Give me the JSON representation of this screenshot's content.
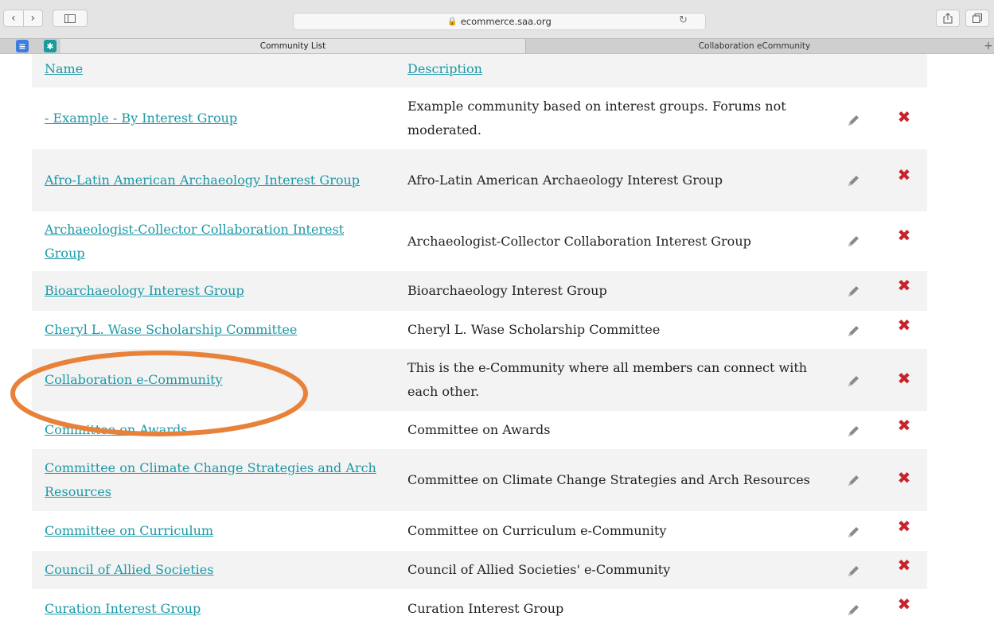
{
  "browser": {
    "url": "ecommerce.saa.org",
    "tabs": [
      {
        "label": "Community List",
        "active": true
      },
      {
        "label": "Collaboration eCommunity",
        "active": false
      }
    ]
  },
  "table": {
    "headers": {
      "name": "Name",
      "description": "Description"
    },
    "rows": [
      {
        "name": "- Example - By Interest Group",
        "description": "Example community based on interest groups. Forums not moderated."
      },
      {
        "name": "Afro-Latin American Archaeology Interest Group",
        "description": "Afro-Latin American Archaeology Interest Group"
      },
      {
        "name": "Archaeologist-Collector Collaboration Interest Group",
        "description": "Archaeologist-Collector Collaboration Interest Group"
      },
      {
        "name": "Bioarchaeology Interest Group",
        "description": "Bioarchaeology Interest Group"
      },
      {
        "name": "Cheryl L. Wase Scholarship Committee",
        "description": "Cheryl L. Wase Scholarship Committee"
      },
      {
        "name": "Collaboration e-Community",
        "description": "This is the e-Community where all members can connect with each other.",
        "highlighted": true
      },
      {
        "name": "Committee on Awards",
        "description": "Committee on Awards"
      },
      {
        "name": "Committee on Climate Change Strategies and Arch Resources",
        "description": "Committee on Climate Change Strategies and Arch Resources"
      },
      {
        "name": "Committee on Curriculum",
        "description": "Committee on Curriculum e-Community"
      },
      {
        "name": "Council of Allied Societies",
        "description": "Council of Allied Societies' e-Community"
      },
      {
        "name": "Curation Interest Group",
        "description": "Curation Interest Group"
      }
    ]
  },
  "colors": {
    "link": "#1b98a7",
    "delete": "#c8232c",
    "highlight_ellipse": "#e8823a"
  },
  "icons": {
    "edit": "pencil-icon",
    "delete": "delete-x-icon"
  }
}
